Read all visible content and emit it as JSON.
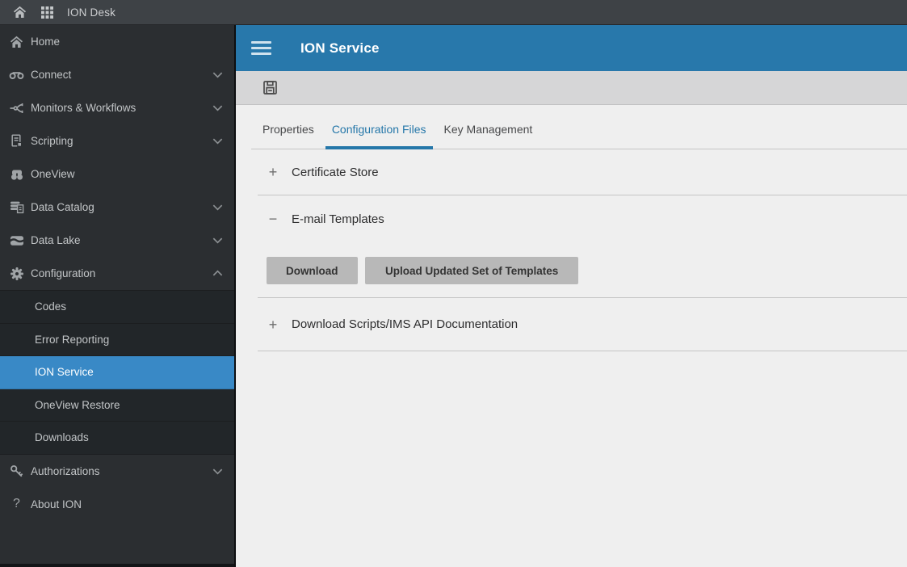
{
  "topbar": {
    "app_title": "ION Desk"
  },
  "sidebar": {
    "items": [
      {
        "label": "Home",
        "icon": "home-icon",
        "chevron": null
      },
      {
        "label": "Connect",
        "icon": "connect-icon",
        "chevron": "down"
      },
      {
        "label": "Monitors & Workflows",
        "icon": "workflows-icon",
        "chevron": "down"
      },
      {
        "label": "Scripting",
        "icon": "scripting-icon",
        "chevron": "down"
      },
      {
        "label": "OneView",
        "icon": "oneview-icon",
        "chevron": null
      },
      {
        "label": "Data Catalog",
        "icon": "data-catalog-icon",
        "chevron": "down"
      },
      {
        "label": "Data Lake",
        "icon": "data-lake-icon",
        "chevron": "down"
      },
      {
        "label": "Configuration",
        "icon": "gear-icon",
        "chevron": "up",
        "expanded": true
      }
    ],
    "configuration_submenu": [
      {
        "label": "Codes",
        "selected": false
      },
      {
        "label": "Error Reporting",
        "selected": false
      },
      {
        "label": "ION Service",
        "selected": true
      },
      {
        "label": "OneView Restore",
        "selected": false
      },
      {
        "label": "Downloads",
        "selected": false
      }
    ],
    "bottom_items": [
      {
        "label": "Authorizations",
        "icon": "key-icon",
        "chevron": "down"
      },
      {
        "label": "About ION",
        "icon": "question-icon",
        "chevron": null
      }
    ]
  },
  "main": {
    "header": {
      "title": "ION Service"
    },
    "toolbar": {
      "save_icon": "save-icon"
    },
    "tabs": [
      {
        "label": "Properties",
        "active": false
      },
      {
        "label": "Configuration Files",
        "active": true
      },
      {
        "label": "Key Management",
        "active": false
      }
    ],
    "sections": [
      {
        "title": "Certificate Store",
        "toggle": "+",
        "state": "collapsed"
      },
      {
        "title": "E-mail Templates",
        "toggle": "−",
        "state": "expanded",
        "buttons": [
          {
            "label": "Download"
          },
          {
            "label": "Upload Updated Set of Templates"
          }
        ]
      },
      {
        "title": "Download Scripts/IMS API Documentation",
        "toggle": "+",
        "state": "collapsed"
      }
    ]
  },
  "colors": {
    "header_blue": "#2878AB",
    "selected_item_blue": "#3989C6",
    "active_tab_blue": "#2577A9",
    "topbar_gray": "#3E4246",
    "sidebar_gray": "#2B2E31"
  }
}
